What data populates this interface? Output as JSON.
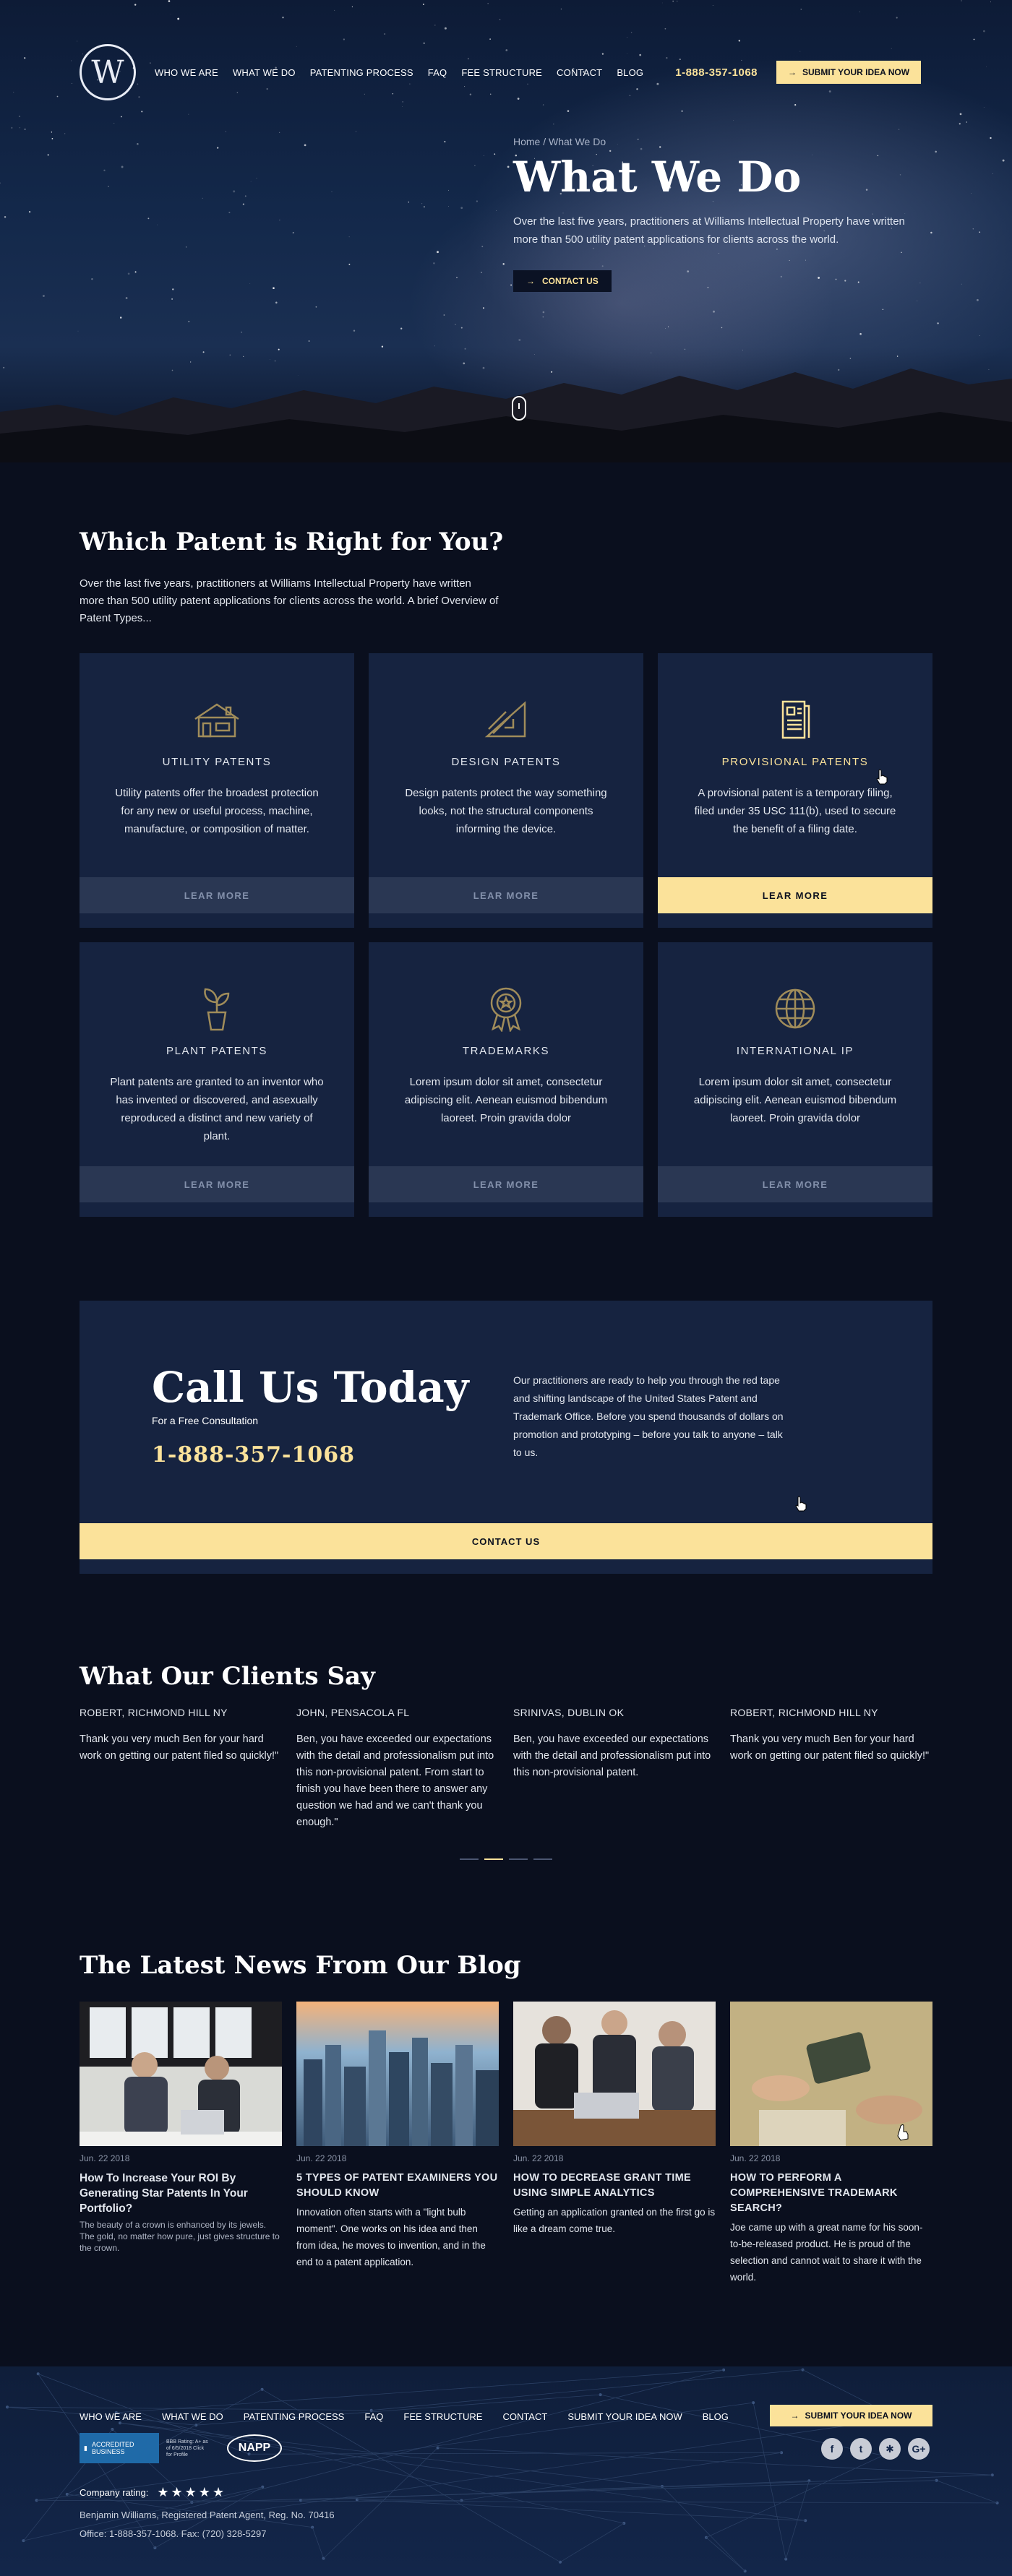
{
  "nav": {
    "links": [
      "WHO WE ARE",
      "WHAT WE DO",
      "PATENTING PROCESS",
      "FAQ",
      "FEE STRUCTURE",
      "CONTACT",
      "BLOG"
    ],
    "phone": "1-888-357-1068",
    "cta": "SUBMIT YOUR IDEA NOW",
    "logo_letter": "W"
  },
  "hero": {
    "breadcrumb": "Home / What We Do",
    "title": "What We Do",
    "subtitle": "Over the last five years, practitioners at Williams Intellectual Property have written more than 500 utility patent applications for clients across the world.",
    "button": "CONTACT US"
  },
  "patents": {
    "title": "Which Patent is Right for You?",
    "lead": "Over the last five years, practitioners at Williams Intellectual Property have written more than 500 utility patent applications for clients across the world. A brief Overview of Patent Types...",
    "cards": [
      {
        "title": "UTILITY PATENTS",
        "text": "Utility patents offer the broadest protection for any new or useful process, machine, manufacture, or composition of matter.",
        "button": "LEAR MORE",
        "icon": "house-icon"
      },
      {
        "title": "DESIGN PATENTS",
        "text": "Design patents protect the way something looks, not the structural components informing the device.",
        "button": "LEAR MORE",
        "icon": "ruler-triangle-icon"
      },
      {
        "title": "PROVISIONAL PATENTS",
        "text": "A provisional patent is a temporary filing, filed under 35 USC 111(b), used to secure the benefit of a filing date.",
        "button": "LEAR MORE",
        "icon": "document-icon"
      },
      {
        "title": "PLANT PATENTS",
        "text": "Plant patents are granted to an inventor who has invented or discovered, and asexually reproduced a distinct and new variety of plant.",
        "button": "LEAR MORE",
        "icon": "plant-icon"
      },
      {
        "title": "TRADEMARKS",
        "text": "Lorem ipsum dolor sit amet, consectetur adipiscing elit. Aenean euismod bibendum laoreet. Proin gravida dolor",
        "button": "LEAR MORE",
        "icon": "award-badge-icon"
      },
      {
        "title": "INTERNATIONAL IP",
        "text": "Lorem ipsum dolor sit amet, consectetur adipiscing elit. Aenean euismod bibendum laoreet. Proin gravida dolor",
        "button": "LEAR MORE",
        "icon": "globe-icon"
      }
    ]
  },
  "call": {
    "title": "Call Us Today",
    "subtitle": "For a Free Consultation",
    "phone": "1-888-357-1068",
    "text": "Our practitioners are ready to help you through the red tape and shifting landscape of the United States Patent and Trademark Office. Before you spend thousands of dollars on promotion and prototyping – before you talk to anyone – talk to us.",
    "button": "CONTACT US"
  },
  "clients": {
    "title": "What Our Clients Say",
    "items": [
      {
        "name": "ROBERT, RICHMOND HILL NY",
        "quote": "Thank you very much Ben for your hard work on getting our patent filed so quickly!\""
      },
      {
        "name": "JOHN, PENSACOLA FL",
        "quote": "Ben, you have exceeded our expectations with the detail and professionalism put into this non-provisional patent. From start to finish you have been there to answer any question we had and we can't thank you enough.\""
      },
      {
        "name": "SRINIVAS, DUBLIN OK",
        "quote": "Ben, you have exceeded our expectations with the detail and professionalism put into this non-provisional patent."
      },
      {
        "name": "ROBERT, RICHMOND HILL NY",
        "quote": "Thank you very much Ben for your hard work on getting our patent filed so quickly!\""
      }
    ]
  },
  "blog": {
    "title": "The Latest News From Our Blog",
    "posts": [
      {
        "date": "Jun. 22 2018",
        "title": "How To Increase Your ROI By Generating Star Patents In Your Portfolio?",
        "desc": "The beauty of a crown is enhanced by its jewels. The gold, no matter how pure, just gives structure to the crown."
      },
      {
        "date": "Jun. 22 2018",
        "title": "5 TYPES OF PATENT EXAMINERS YOU SHOULD KNOW",
        "desc": "Innovation often starts with a \"light bulb moment\". One works on his idea and then from idea, he moves to invention, and in the end to a patent application."
      },
      {
        "date": "Jun. 22 2018",
        "title": "HOW TO DECREASE GRANT TIME USING SIMPLE ANALYTICS",
        "desc": "Getting an application granted on the first go is like a dream come true."
      },
      {
        "date": "Jun. 22 2018",
        "title": "HOW TO PERFORM A COMPREHENSIVE TRADEMARK SEARCH?",
        "desc": "Joe came up with a great name for his soon-to-be-released product. He is proud of the selection and cannot wait to share it with the world."
      }
    ]
  },
  "footer": {
    "links": [
      "WHO WE ARE",
      "WHAT WE DO",
      "PATENTING PROCESS",
      "FAQ",
      "FEE STRUCTURE",
      "CONTACT",
      "SUBMIT YOUR IDEA NOW",
      "BLOG"
    ],
    "cta": "SUBMIT YOUR IDEA NOW",
    "bbb_seal": "ACCREDITED BUSINESS",
    "bbb_side": "BBB Rating: A+ as of 6/5/2018 Click for Profile",
    "napp": "NAPP",
    "rating_label": "Company rating:",
    "stars": "★★★★★",
    "agent": "Benjamin Williams, Registered Patent Agent, Reg. No. 70416",
    "contact": "Office: 1-888-357-1068. Fax: (720) 328-5297",
    "social": [
      "facebook-icon",
      "twitter-icon",
      "yelp-icon",
      "google-plus-icon"
    ]
  }
}
